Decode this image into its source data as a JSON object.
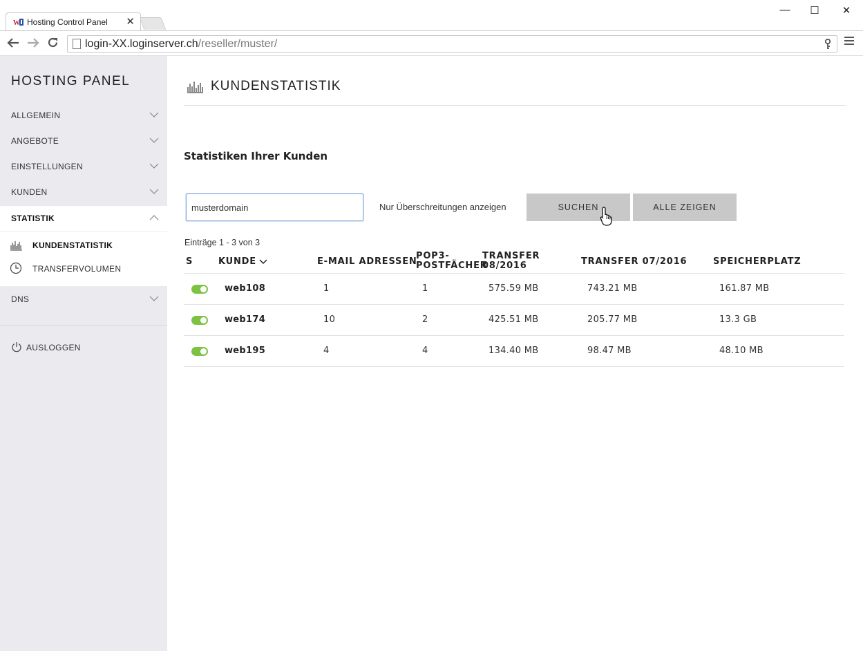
{
  "browser": {
    "tab_title": "Hosting Control Panel",
    "tab_close": "✕",
    "url_host": "login-XX.loginserver.ch",
    "url_path": "/reseller/muster/",
    "win_minimize": "—",
    "win_maximize": "☐",
    "win_close": "✕"
  },
  "sidebar": {
    "brand": "HOSTING PANEL",
    "items": [
      {
        "label": "ALLGEMEIN",
        "expanded": false
      },
      {
        "label": "ANGEBOTE",
        "expanded": false
      },
      {
        "label": "EINSTELLUNGEN",
        "expanded": false
      },
      {
        "label": "KUNDEN",
        "expanded": false
      },
      {
        "label": "STATISTIK",
        "expanded": true
      },
      {
        "label": "DNS",
        "expanded": false
      }
    ],
    "sub_items": [
      {
        "label": "KUNDENSTATISTIK",
        "icon": "bar-chart-icon",
        "active": true
      },
      {
        "label": "TRANSFERVOLUMEN",
        "icon": "clock-icon",
        "active": false
      }
    ],
    "logout_label": "AUSLOGGEN"
  },
  "main": {
    "title": "KUNDENSTATISTIK",
    "section_title": "Statistiken Ihrer Kunden",
    "search_value": "musterdomain",
    "filter_label": "Nur Überschreitungen anzeigen",
    "search_button": "SUCHEN",
    "show_all_button": "ALLE ZEIGEN",
    "entries_text": "Einträge 1 - 3 von 3"
  },
  "table": {
    "headers": {
      "status": "S",
      "customer": "KUNDE",
      "email": "E-MAIL ADRESSEN",
      "pop3_line1": "POP3-",
      "pop3_line2": "POSTFÄCHER",
      "transfer_cur_line1": "TRANSFER",
      "transfer_cur_line2": "08/2016",
      "transfer_prev": "TRANSFER 07/2016",
      "storage": "SPEICHERPLATZ"
    },
    "rows": [
      {
        "active": true,
        "customer": "web108",
        "email": "1",
        "pop3": "1",
        "transfer_cur": "575.59 MB",
        "transfer_prev": "743.21 MB",
        "storage": "161.87 MB"
      },
      {
        "active": true,
        "customer": "web174",
        "email": "10",
        "pop3": "2",
        "transfer_cur": "425.51 MB",
        "transfer_prev": "205.77 MB",
        "storage": "13.3 GB"
      },
      {
        "active": true,
        "customer": "web195",
        "email": "4",
        "pop3": "4",
        "transfer_cur": "134.40 MB",
        "transfer_prev": "98.47 MB",
        "storage": "48.10 MB"
      }
    ]
  },
  "colors": {
    "toggle_on": "#7cc243",
    "sidebar_bg": "#ebebef",
    "button_bg": "#c8c8c8"
  }
}
